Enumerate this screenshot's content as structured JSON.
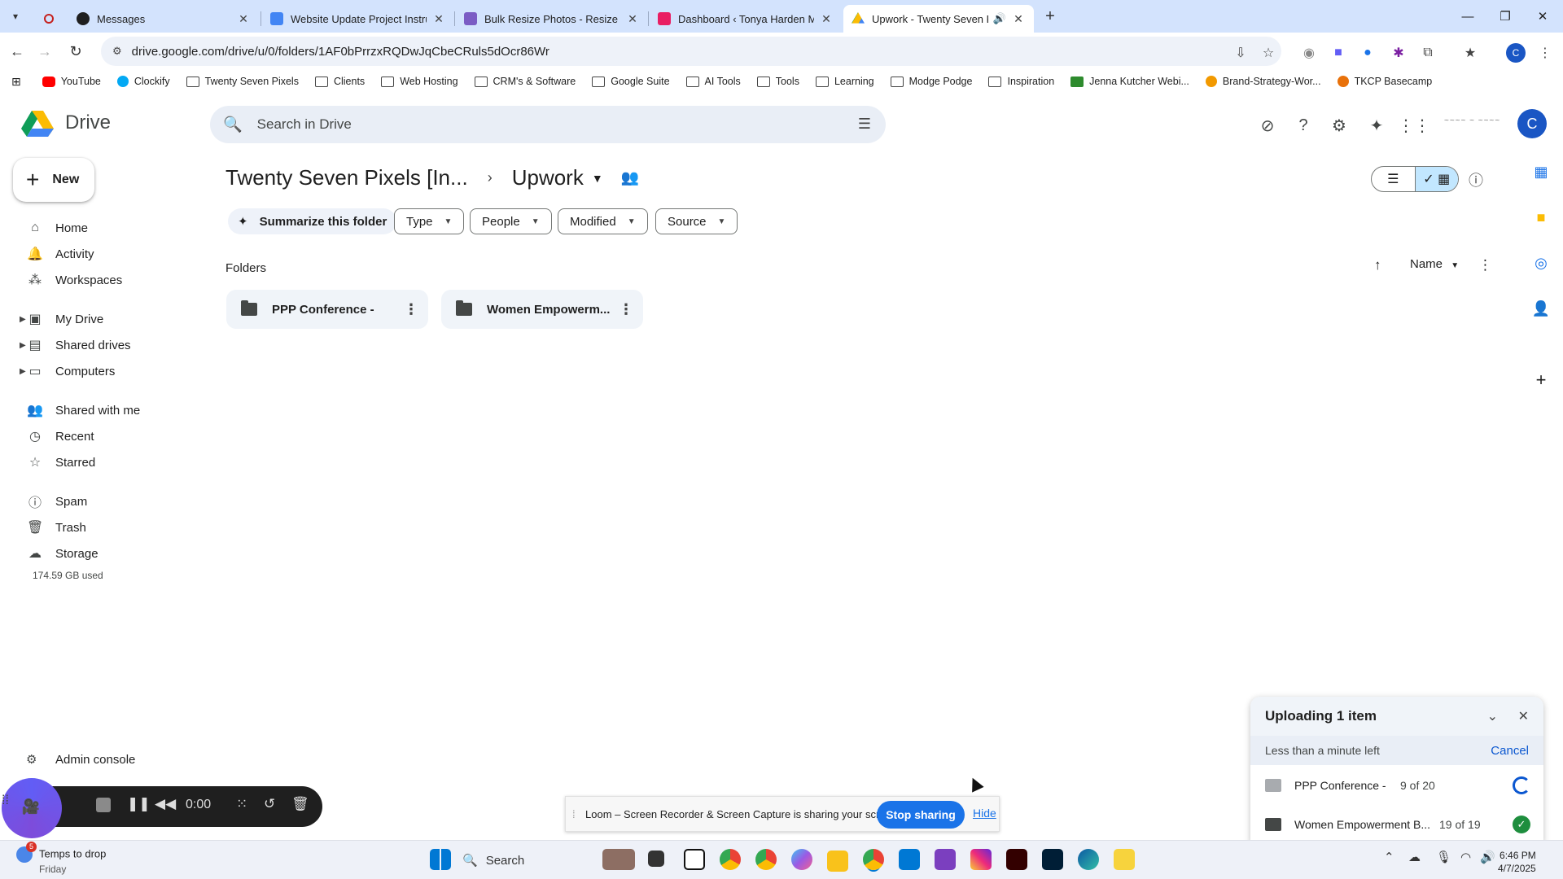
{
  "browser": {
    "tabs": [
      {
        "title": "Messages",
        "fav_color": "#1f1f1f"
      },
      {
        "title": "Website Update Project Instructions",
        "fav_color": "#4285f4"
      },
      {
        "title": "Bulk Resize Photos - Resize Images",
        "fav_color": "#7b5cc4"
      },
      {
        "title": "Dashboard ‹ Tonya Harden Ministries",
        "fav_color": "#e91e63"
      },
      {
        "title": "Upwork - Twenty Seven Pixels",
        "fav_color": "#34a853"
      }
    ],
    "active_tab_index": 4,
    "new_tab_label": "+",
    "url": "drive.google.com/drive/u/0/folders/1AF0bPrrzxRQDwJqCbeCRuls5dOcr86Wr"
  },
  "bookmarks": [
    {
      "label": "YouTube",
      "icon": "youtube-icon",
      "style": "yt"
    },
    {
      "label": "Clockify",
      "icon": "clockify-icon",
      "style": "ck"
    },
    {
      "label": "Twenty Seven Pixels",
      "icon": "folder-icon",
      "style": ""
    },
    {
      "label": "Clients",
      "icon": "folder-icon",
      "style": ""
    },
    {
      "label": "Web Hosting",
      "icon": "folder-icon",
      "style": ""
    },
    {
      "label": "CRM's & Software",
      "icon": "folder-icon",
      "style": ""
    },
    {
      "label": "Google Suite",
      "icon": "folder-icon",
      "style": ""
    },
    {
      "label": "AI Tools",
      "icon": "folder-icon",
      "style": ""
    },
    {
      "label": "Tools",
      "icon": "folder-icon",
      "style": ""
    },
    {
      "label": "Learning",
      "icon": "folder-icon",
      "style": ""
    },
    {
      "label": "Modge Podge",
      "icon": "folder-icon",
      "style": ""
    },
    {
      "label": "Inspiration",
      "icon": "folder-icon",
      "style": ""
    },
    {
      "label": "Jenna Kutcher Webi...",
      "icon": "jk-icon",
      "style": "green"
    },
    {
      "label": "Brand-Strategy-Wor...",
      "icon": "brand-icon",
      "style": "brand"
    },
    {
      "label": "TKCP Basecamp",
      "icon": "basecamp-icon",
      "style": "tkcp"
    }
  ],
  "drive": {
    "app_name": "Drive",
    "search_placeholder": "Search in Drive",
    "avatar_initial": "C",
    "new_button": "New",
    "nav": [
      {
        "label": "Home",
        "icon": "home-icon"
      },
      {
        "label": "Activity",
        "icon": "activity-icon"
      },
      {
        "label": "Workspaces",
        "icon": "workspaces-icon"
      },
      {
        "label": "My Drive",
        "icon": "my-drive-icon"
      },
      {
        "label": "Shared drives",
        "icon": "shared-drives-icon"
      },
      {
        "label": "Computers",
        "icon": "computers-icon"
      },
      {
        "label": "Shared with me",
        "icon": "shared-with-me-icon"
      },
      {
        "label": "Recent",
        "icon": "recent-icon"
      },
      {
        "label": "Starred",
        "icon": "star-icon"
      },
      {
        "label": "Spam",
        "icon": "spam-icon"
      },
      {
        "label": "Trash",
        "icon": "trash-icon"
      },
      {
        "label": "Storage",
        "icon": "cloud-icon"
      }
    ],
    "storage_used": "174.59 GB used",
    "admin_console": "Admin console",
    "breadcrumb": {
      "parent": "Twenty Seven Pixels [In...",
      "current": "Upwork"
    },
    "chips": {
      "summarize": "Summarize this folder",
      "type": "Type",
      "people": "People",
      "modified": "Modified",
      "source": "Source"
    },
    "folders_title": "Folders",
    "sort_label": "Name",
    "folders": [
      {
        "name": "PPP Conference -"
      },
      {
        "name": "Women Empowerm..."
      }
    ]
  },
  "upload_panel": {
    "title": "Uploading 1 item",
    "time_left": "Less than a minute left",
    "cancel": "Cancel",
    "items": [
      {
        "name": "PPP Conference -",
        "count": "9 of 20",
        "status": "in-progress"
      },
      {
        "name": "Women Empowerment B...",
        "count": "19 of 19",
        "status": "done"
      }
    ]
  },
  "loom": {
    "timer": "0:00",
    "message": "Loom – Screen Recorder & Screen Capture is sharing your screen.",
    "stop_sharing": "Stop sharing",
    "hide": "Hide"
  },
  "taskbar": {
    "weather_badge": "5",
    "weather_line1": "Temps to drop",
    "weather_line2": "Friday",
    "search_label": "Search",
    "time": "6:46 PM",
    "date": "4/7/2025"
  },
  "colors": {
    "accent": "#0b57d0",
    "chrome_frame": "#d3e3fd",
    "search_bg": "#e9eef6",
    "folder_card": "#f0f4f9",
    "success": "#1e8e3e"
  }
}
